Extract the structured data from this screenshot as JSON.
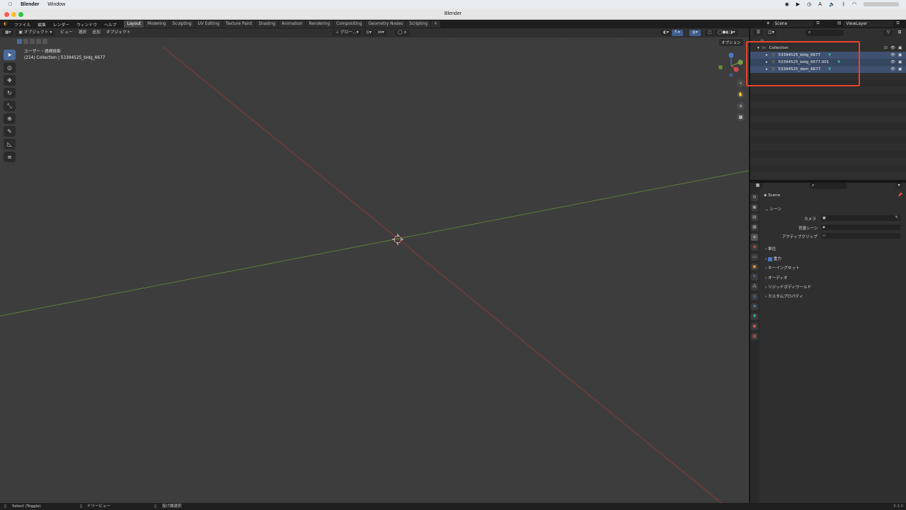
{
  "mac": {
    "app": "Blender",
    "menu": [
      "Window"
    ]
  },
  "window": {
    "title": "Blender"
  },
  "topbar": {
    "menus": [
      "ファイル",
      "編集",
      "レンダー",
      "ウィンドウ",
      "ヘルプ"
    ],
    "workspaces": [
      "Layout",
      "Modeling",
      "Sculpting",
      "UV Editing",
      "Texture Paint",
      "Shading",
      "Animation",
      "Rendering",
      "Compositing",
      "Geometry Nodes",
      "Scripting"
    ],
    "active_workspace": "Layout",
    "scene": "Scene",
    "view_layer": "ViewLayer"
  },
  "viewport": {
    "mode": "オブジェクト",
    "menus": [
      "ビュー",
      "選択",
      "追加",
      "オブジェクト"
    ],
    "orientation": "グロー...",
    "info_line1": "ユーザー・透視投影",
    "info_line2": "(214) Collection | 53394525_bldg_6677",
    "options_label": "オプション"
  },
  "outliner": {
    "collection": "Collection",
    "items": [
      {
        "name": "53394525_bldg_6677"
      },
      {
        "name": "53394525_bldg_6677.001"
      },
      {
        "name": "53394525_dem_6677"
      }
    ]
  },
  "properties": {
    "scene_name": "Scene",
    "section": "シーン",
    "fields": [
      {
        "label": "カメラ"
      },
      {
        "label": "背景シーン"
      },
      {
        "label": "アクティブクリップ"
      }
    ],
    "panels": [
      "単位",
      "重力",
      "キーイングセット",
      "オーディオ",
      "リジッドボディワールド",
      "カスタムプロパティ"
    ]
  },
  "statusbar": {
    "left": "Select (Toggle)",
    "mid": "ドリービュー",
    "right": "投げ縄選択",
    "version": "3.3.0"
  },
  "colors": {
    "x_axis": "#8a3a3a",
    "y_axis": "#5e7a3a",
    "highlight": "#e8432c",
    "selection": "#3f5170"
  }
}
